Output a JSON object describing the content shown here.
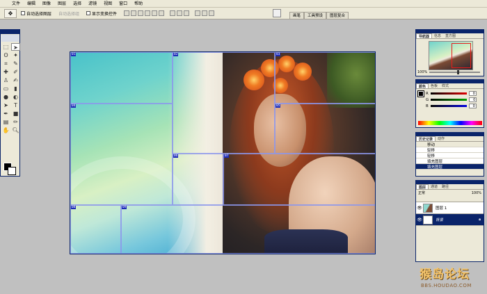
{
  "menu": [
    "文件",
    "编辑",
    "图像",
    "图层",
    "选择",
    "滤镜",
    "视图",
    "窗口",
    "帮助"
  ],
  "options": {
    "auto_select_layer": "自动选择图层",
    "auto_select_group": "自动选择组",
    "show_transform": "显示变换控件"
  },
  "dock_tabs": [
    "画笔",
    "工具预设",
    "图层复合"
  ],
  "slices": [
    {
      "id": "01"
    },
    {
      "id": "02"
    },
    {
      "id": "03"
    },
    {
      "id": "04"
    },
    {
      "id": "05"
    },
    {
      "id": "06"
    },
    {
      "id": "07"
    },
    {
      "id": "08"
    },
    {
      "id": "09"
    },
    {
      "id": "10"
    },
    {
      "id": "11"
    }
  ],
  "navigator": {
    "tabs": [
      "导航器",
      "信息",
      "直方图"
    ],
    "zoom": "100%"
  },
  "color_panel": {
    "tabs": [
      "颜色",
      "色板",
      "样式"
    ],
    "channels": [
      {
        "name": "R",
        "value": "0",
        "color": "#e00000"
      },
      {
        "name": "G",
        "value": "0",
        "color": "#00a000"
      },
      {
        "name": "B",
        "value": "0",
        "color": "#0000e0"
      }
    ]
  },
  "history": {
    "tabs": [
      "历史记录",
      "动作"
    ],
    "items": [
      "移动",
      "轻移",
      "轻移",
      "填充图层",
      "填充图层"
    ]
  },
  "layers": {
    "tabs": [
      "图层",
      "通道",
      "路径"
    ],
    "mode": "正常",
    "opacity": "100%",
    "items": [
      "图层 1",
      "背景"
    ]
  },
  "watermark": {
    "big": "猴岛论坛",
    "small": "BBS.HOUDAO.COM"
  }
}
